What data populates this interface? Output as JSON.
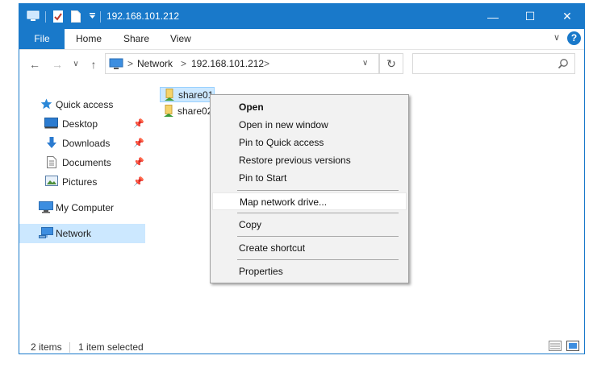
{
  "window": {
    "title": "192.168.101.212",
    "accent": "#1979ca",
    "controls": {
      "minimize": "—",
      "maximize": "☐",
      "close": "✕"
    }
  },
  "quick_access_toolbar": [
    "computer-icon",
    "properties-check-icon",
    "new-folder-icon",
    "customize-dropdown-icon"
  ],
  "ribbon": {
    "tabs": [
      {
        "label": "File",
        "active": true
      },
      {
        "label": "Home"
      },
      {
        "label": "Share"
      },
      {
        "label": "View"
      }
    ],
    "expand_glyph": "∨",
    "help_glyph": "?"
  },
  "navigation": {
    "back": "←",
    "forward": "→",
    "recent": "∨",
    "up": "↑",
    "breadcrumbs": [
      "Network",
      "192.168.101.212"
    ],
    "separator": ">",
    "address_dropdown": "∨",
    "refresh": "↻",
    "search": {
      "placeholder": "",
      "value": ""
    }
  },
  "nav_pane": {
    "quick_access": "Quick access",
    "items": [
      {
        "label": "Desktop",
        "pinned": true
      },
      {
        "label": "Downloads",
        "pinned": true
      },
      {
        "label": "Documents",
        "pinned": true
      },
      {
        "label": "Pictures",
        "pinned": true
      }
    ],
    "my_computer": "My Computer",
    "network": "Network",
    "pin_glyph": "📌"
  },
  "content": {
    "items": [
      {
        "name": "share01",
        "selected": true
      },
      {
        "name": "share02",
        "selected": false
      }
    ]
  },
  "status_bar": {
    "count": "2 items",
    "selection": "1 item selected"
  },
  "context_menu": {
    "items": [
      {
        "label": "Open",
        "bold": true
      },
      {
        "label": "Open in new window"
      },
      {
        "label": "Pin to Quick access"
      },
      {
        "label": "Restore previous versions"
      },
      {
        "label": "Pin to Start"
      },
      {
        "label": "Map network drive...",
        "highlighted": true
      },
      {
        "label": "Copy"
      },
      {
        "label": "Create shortcut"
      },
      {
        "label": "Properties"
      }
    ]
  }
}
